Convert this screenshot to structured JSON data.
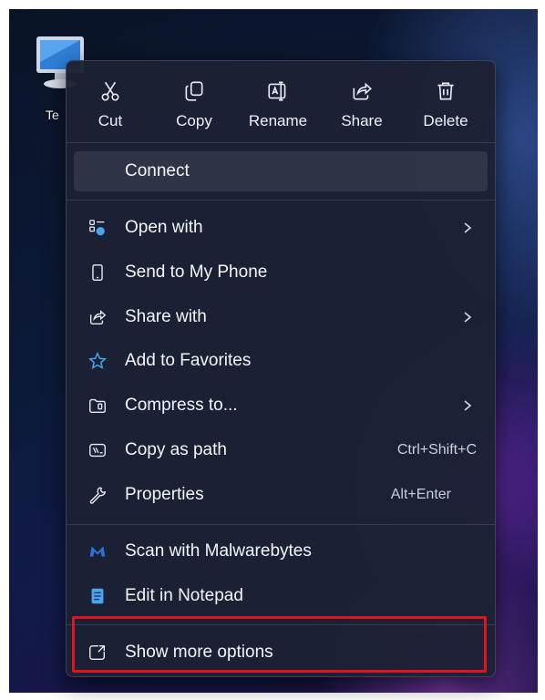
{
  "desktop": {
    "icon_label": "Te"
  },
  "top_actions": [
    {
      "label": "Cut",
      "icon": "scissors-icon"
    },
    {
      "label": "Copy",
      "icon": "copy-icon"
    },
    {
      "label": "Rename",
      "icon": "rename-icon"
    },
    {
      "label": "Share",
      "icon": "share-icon"
    },
    {
      "label": "Delete",
      "icon": "trash-icon"
    }
  ],
  "items": {
    "connect": {
      "label": "Connect"
    },
    "open_with": {
      "label": "Open with",
      "icon": "open-with-icon"
    },
    "send_to_phone": {
      "label": "Send to My Phone",
      "icon": "phone-icon"
    },
    "share_with": {
      "label": "Share with",
      "icon": "share-with-icon"
    },
    "add_favorites": {
      "label": "Add to Favorites",
      "icon": "star-icon"
    },
    "compress": {
      "label": "Compress to...",
      "icon": "archive-icon"
    },
    "copy_path": {
      "label": "Copy as path",
      "shortcut": "Ctrl+Shift+C",
      "icon": "path-icon"
    },
    "properties": {
      "label": "Properties",
      "shortcut": "Alt+Enter",
      "icon": "wrench-icon"
    },
    "malwarebytes": {
      "label": "Scan with Malwarebytes",
      "icon": "malwarebytes-icon"
    },
    "notepad": {
      "label": "Edit in Notepad",
      "icon": "notepad-icon"
    },
    "more_options": {
      "label": "Show more options",
      "icon": "show-more-icon"
    }
  },
  "colors": {
    "menu_bg": "#1c2134",
    "accent_blue": "#4aa3f0",
    "highlight_red": "#e0141c"
  }
}
